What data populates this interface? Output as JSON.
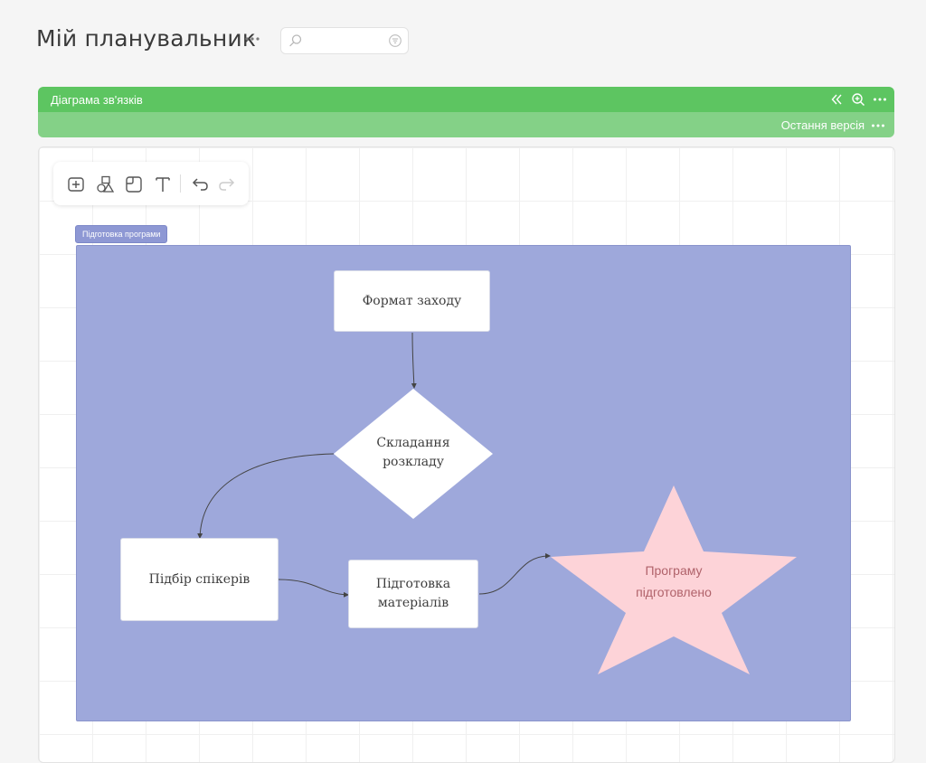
{
  "header": {
    "title": "Мій планувальник",
    "more_icon": "more-horizontal-icon",
    "search": {
      "value": "",
      "placeholder": ""
    }
  },
  "panel": {
    "title": "Діаграма зв'язків",
    "version_label": "Остання версія",
    "actions": [
      "collapse-icon",
      "zoom-in-icon",
      "more-horizontal-icon"
    ],
    "header_color": "#5dc561",
    "subheader_color": "#84d187"
  },
  "toolbar": {
    "tools": [
      "add-shape-icon",
      "shapes-icon",
      "sticky-note-icon",
      "text-icon",
      "undo-icon",
      "redo-icon"
    ]
  },
  "diagram": {
    "frame_label": "Підготовка програми",
    "frame_color": "#9ea8db",
    "nodes": {
      "format": "Формат заходу",
      "schedule_line1": "Складання",
      "schedule_line2": "розкладу",
      "speakers": "Підбір спікерів",
      "materials_line1": "Підготовка",
      "materials_line2": "матеріалів",
      "done_line1": "Програму",
      "done_line2": "підготовлено"
    },
    "star_color": "#fdd3d8"
  }
}
